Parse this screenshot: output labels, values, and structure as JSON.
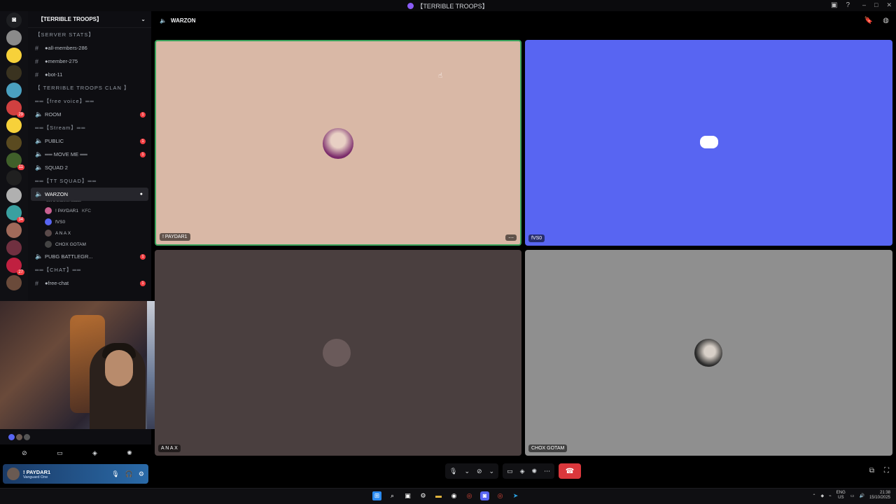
{
  "window": {
    "title": "【TERRIBLE TROOPS】"
  },
  "server": {
    "name": "【TERRIBLE TROOPS】"
  },
  "channels": [
    {
      "kind": "text",
      "label": "【SERVER STATS】",
      "type": "cat"
    },
    {
      "kind": "text",
      "label": "●all-members-286"
    },
    {
      "kind": "text",
      "label": "●member-275"
    },
    {
      "kind": "text",
      "label": "●bot-11"
    },
    {
      "kind": "cat",
      "label": "【 TERRIBLE TROOPS CLAN 】"
    },
    {
      "kind": "cat",
      "label": "══【free voice】══"
    },
    {
      "kind": "voice",
      "label": "ROOM",
      "badge": "1"
    },
    {
      "kind": "cat",
      "label": "══【Stream】══"
    },
    {
      "kind": "voice",
      "label": "PUBLIC",
      "badge": "1"
    },
    {
      "kind": "voice",
      "label": "══ MOVE ME ══",
      "badge": "1"
    },
    {
      "kind": "voice",
      "label": "SQUAD 2"
    },
    {
      "kind": "cat",
      "label": "══【TT SQUAD】══"
    },
    {
      "kind": "voice",
      "label": "WARZON",
      "active": true,
      "status": "Set a channel status"
    },
    {
      "kind": "voice",
      "label": "PUBG BATTLEGR...",
      "badge": "1"
    },
    {
      "kind": "cat",
      "label": "══【CHAT】══"
    },
    {
      "kind": "text",
      "label": "●free-chat",
      "badge": "1"
    }
  ],
  "members": [
    {
      "name": "! PAYDAR1",
      "tag": "KFC"
    },
    {
      "name": "fVS0"
    },
    {
      "name": "A N A X"
    },
    {
      "name": "CHOX GOTAM"
    }
  ],
  "call": {
    "channel_name": "WARZON",
    "tiles": [
      {
        "name": "! PAYDAR1",
        "bg": "#d9b8a6"
      },
      {
        "name": "fVS0",
        "bg": "#5865f2"
      },
      {
        "name": "A N A X",
        "bg": "#4a3f3f"
      },
      {
        "name": "CHOX GOTAM",
        "bg": "#8f8f8f"
      }
    ]
  },
  "user_panel": {
    "name": "! PAYDAR1",
    "status": "Vanguard One"
  },
  "taskbar": {
    "lang": "ENG",
    "region": "US",
    "time": "21:38",
    "date": "15/10/2025"
  },
  "colors": {
    "accent": "#5865f2",
    "danger": "#da373c",
    "speaking": "#3ba55d"
  },
  "icons": {
    "mic": "mic-icon",
    "camera": "camera-icon",
    "hangup": "hangup-icon"
  }
}
